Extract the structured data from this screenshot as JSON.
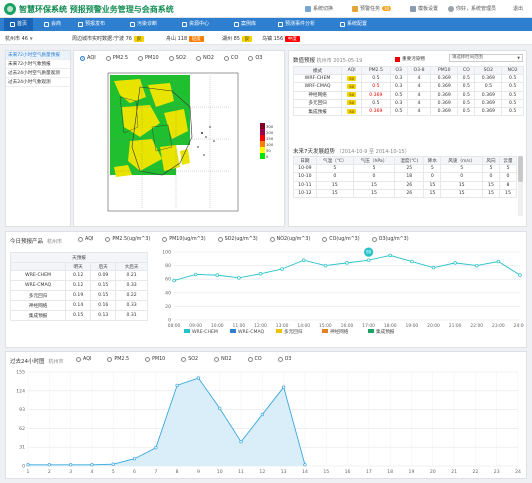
{
  "header": {
    "title": "智慧环保系统",
    "subtitle": "预报预警业务管理与会商系统",
    "system_switch": "系统切换",
    "alert_tasks": "预警任务",
    "alert_count": "10",
    "template_settings": "模板设置",
    "user_greeting": "你好，系统管理员",
    "logout": "退出"
  },
  "nav": {
    "items": [
      "首页",
      "会商",
      "预报发布",
      "污染诊断",
      "资源中心",
      "案例库",
      "预测事件分析",
      "系统配置"
    ],
    "active_index": 0
  },
  "city_row": {
    "city": "杭州市",
    "city_aqi": "46",
    "surround_label": "周边城市实时数据：",
    "cities": [
      {
        "name": "宁波",
        "aqi": "76",
        "level": "良",
        "color": "#f5d200"
      },
      {
        "name": "舟山",
        "aqi": "118",
        "level": "轻度",
        "color": "#ff7e00"
      },
      {
        "name": "湖州",
        "aqi": "85",
        "level": "良",
        "color": "#f5d200"
      },
      {
        "name": "乌镇",
        "aqi": "156",
        "level": "中度",
        "color": "#ff0000"
      }
    ]
  },
  "left_menu": {
    "items": [
      "未来72小时空气质量预报",
      "未来72小时气象预报",
      "过去24小时空气质量观测",
      "过去24小时气象观测"
    ],
    "active_index": 0
  },
  "map_panel": {
    "pollutants": [
      "AQI",
      "PM2.5",
      "PM10",
      "SO2",
      "NO2",
      "CO",
      "O3"
    ],
    "selected": "AQI",
    "legend": [
      {
        "label": "300",
        "color": "#7e0023"
      },
      {
        "label": "200",
        "color": "#99004c"
      },
      {
        "label": "150",
        "color": "#ff0000"
      },
      {
        "label": "100",
        "color": "#ff7e00"
      },
      {
        "label": "50",
        "color": "#ffff00"
      },
      {
        "label": "0",
        "color": "#00e400"
      }
    ]
  },
  "forecast_table": {
    "title": "数值预报",
    "city": "杭州市",
    "date": "2015-05-19",
    "legend_label": "重要污染物",
    "select_placeholder": "请选择时间范围",
    "columns": [
      "模式",
      "AQI",
      "PM2.5",
      "O3",
      "O3-8",
      "PM10",
      "CO",
      "SO2",
      "NO2"
    ],
    "rows": [
      {
        "model": "WRF-CHEM",
        "aqi": "50",
        "values": [
          "0.5",
          "0.3",
          "4",
          "0.369",
          "0.5",
          "0.369",
          "0.5"
        ],
        "red_index": -1
      },
      {
        "model": "WRF-CMAQ",
        "aqi": "50",
        "values": [
          "0.5",
          "0.3",
          "4",
          "0.369",
          "0.5",
          "0.5",
          "0.5"
        ],
        "red_index": 0
      },
      {
        "model": "神经网络",
        "aqi": "50",
        "values": [
          "0.369",
          "0.5",
          "4",
          "0.369",
          "0.5",
          "0.369",
          "0.5"
        ],
        "red_index": 0
      },
      {
        "model": "多元回归",
        "aqi": "50",
        "values": [
          "0.5",
          "0.3",
          "4",
          "0.369",
          "0.5",
          "0.369",
          "0.5"
        ],
        "red_index": -1
      },
      {
        "model": "集成预报",
        "aqi": "50",
        "values": [
          "0.369",
          "0.5",
          "4",
          "0.369",
          "0.5",
          "0.369",
          "0.5"
        ],
        "red_index": 0
      }
    ]
  },
  "weather_table": {
    "title": "未来7天发展趋势",
    "range": "（2014-10-9 至 2014-10-15）",
    "columns": [
      "日期",
      "气温（℃）",
      "气压（hPa）",
      "湿度(℃)",
      "降水",
      "风速（m/s）",
      "风向",
      "云量"
    ],
    "rows": [
      [
        "10-09",
        "5",
        "5",
        "25",
        "5",
        "5",
        "5",
        "5"
      ],
      [
        "10-10",
        "0",
        "0",
        "18",
        "0",
        "0",
        "0",
        "0"
      ],
      [
        "10-11",
        "15",
        "15",
        "26",
        "15",
        "15",
        "15",
        "8"
      ],
      [
        "10-12",
        "15",
        "15",
        "26",
        "15",
        "15",
        "15",
        "15"
      ]
    ]
  },
  "today": {
    "title": "今日预报产品",
    "city": "杭州市",
    "pollutants": [
      "AQI",
      "PM2.5(ug/m^3)",
      "PM10(ug/m^3)",
      "SO2(ug/m^3)",
      "NO2(ug/m^3)",
      "CO(ug/m^3)",
      "O3(ug/m^3)"
    ],
    "table_title": "天预报",
    "table_columns": [
      "",
      "明天",
      "后天",
      "大后天"
    ],
    "table_rows": [
      [
        "WRE-CHEM",
        "0.12",
        "0.09",
        "0.21"
      ],
      [
        "WRE-CMAQ",
        "0.12",
        "0.15",
        "0.33"
      ],
      [
        "多元回归",
        "0.19",
        "0.15",
        "0.22"
      ],
      [
        "神经网络",
        "0.14",
        "0.16",
        "0.33"
      ],
      [
        "集成预报",
        "0.15",
        "0.13",
        "0.31"
      ]
    ],
    "legend": [
      "WRE-CHEM",
      "WRE-CMAQ",
      "多元回归",
      "神经网络",
      "集成预报"
    ],
    "legend_colors": [
      "#26c2c9",
      "#2f7fd0",
      "#f2c200",
      "#e67e22",
      "#1aa260"
    ]
  },
  "past": {
    "title": "过去24小时图",
    "city": "杭州市",
    "pollutants": [
      "AQI",
      "PM2.5",
      "PM10",
      "SO2",
      "NO2",
      "CO",
      "O3"
    ]
  },
  "chart_data": [
    {
      "type": "line",
      "x": [
        "08:00",
        "09:00",
        "10:00",
        "11:00",
        "12:00",
        "13:00",
        "14:00",
        "15:00",
        "16:00",
        "17:00",
        "18:00",
        "19:00",
        "20:00",
        "21:00",
        "22:00",
        "23:00",
        "24:00"
      ],
      "y": [
        58,
        67,
        66,
        62,
        68,
        75,
        88,
        80,
        84,
        88,
        95,
        86,
        77,
        84,
        80,
        86,
        66
      ],
      "ylim": [
        0,
        100
      ],
      "yticks": [
        0,
        20,
        40,
        60,
        80,
        100
      ],
      "highlight": {
        "index": 9,
        "label": "89"
      }
    },
    {
      "type": "area",
      "x": [
        "1",
        "2",
        "3",
        "4",
        "5",
        "6",
        "7",
        "8",
        "9",
        "10",
        "11",
        "12",
        "13",
        "14",
        "15",
        "16",
        "17",
        "18",
        "19",
        "20",
        "21",
        "22",
        "23",
        "24"
      ],
      "y": [
        2,
        2,
        2,
        2,
        3,
        12,
        30,
        133,
        145,
        95,
        40,
        85,
        130,
        2,
        null,
        null,
        null,
        null,
        null,
        null,
        null,
        null,
        null,
        null
      ],
      "ylim": [
        0,
        155
      ],
      "yticks": [
        0,
        31,
        62,
        93,
        124,
        155
      ]
    }
  ]
}
